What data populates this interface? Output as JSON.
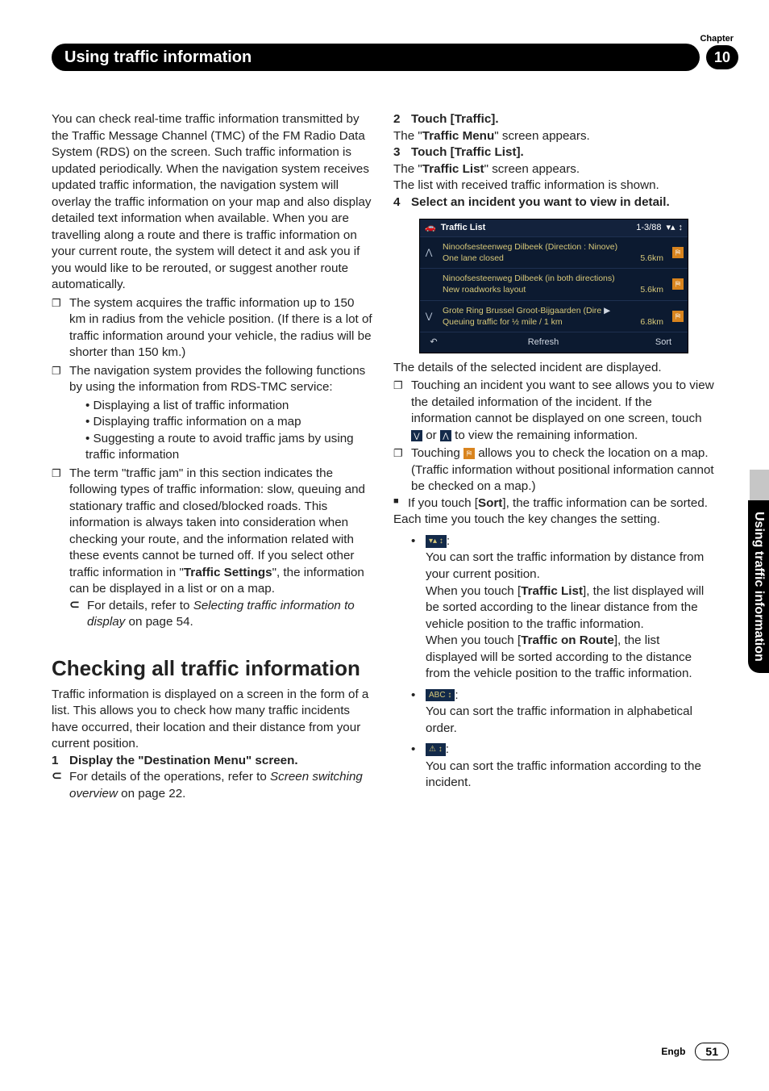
{
  "header": {
    "chapter_label": "Chapter",
    "title": "Using traffic information",
    "chapter_number": "10"
  },
  "side_tab": "Using traffic information",
  "left": {
    "intro": "You can check real-time traffic information transmitted by the Traffic Message Channel (TMC) of the FM Radio Data System (RDS) on the screen. Such traffic information is updated periodically. When the navigation system receives updated traffic information, the navigation system will overlay the traffic information on your map and also display detailed text information when available. When you are travelling along a route and there is traffic information on your current route, the system will detect it and ask you if you would like to be rerouted, or suggest another route automatically.",
    "note1": "The system acquires the traffic information up to 150 km in radius from the vehicle position. (If there is a lot of traffic information around your vehicle, the radius will be shorter than 150 km.)",
    "note2": "The navigation system provides the following functions by using the information from RDS-TMC service:",
    "bullets": [
      "Displaying a list of traffic information",
      "Displaying traffic information on a map",
      "Suggesting a route to avoid traffic jams by using traffic information"
    ],
    "note3_a": "The term \"traffic jam\" in this section indicates the following types of traffic information: slow, queuing and stationary traffic and closed/blocked roads. This information is always taken into consideration when checking your route, and the information related with these events cannot be turned off. If you select other traffic information in \"",
    "note3_bold": "Traffic Settings",
    "note3_b": "\", the information can be displayed in a list or on a map.",
    "note3_ref_a": "For details, refer to ",
    "note3_ref_i": "Selecting traffic information to display",
    "note3_ref_b": " on page 54.",
    "section": "Checking all traffic information",
    "section_p": "Traffic information is displayed on a screen in the form of a list. This allows you to check how many traffic incidents have occurred, their location and their distance from your current position.",
    "step1_n": "1",
    "step1": "Display the \"Destination Menu\" screen.",
    "step1_ref_a": "For details of the operations, refer to ",
    "step1_ref_i": "Screen switching overview",
    "step1_ref_b": " on page 22."
  },
  "right": {
    "step2_n": "2",
    "step2": "Touch [Traffic].",
    "step2_p_a": "The \"",
    "step2_p_b": "Traffic Menu",
    "step2_p_c": "\" screen appears.",
    "step3_n": "3",
    "step3": "Touch [Traffic List].",
    "step3_p_a": "The \"",
    "step3_p_b": "Traffic List",
    "step3_p_c": "\" screen appears.",
    "step3_p2": "The list with received traffic information is shown.",
    "step4_n": "4",
    "step4": "Select an incident you want to view in detail.",
    "step4_after": "The details of the selected incident are displayed.",
    "sub1_a": "Touching an incident you want to see allows you to view the detailed information of the incident. If the information cannot be displayed on one screen, touch ",
    "sub1_b": " or ",
    "sub1_c": " to view the remaining information.",
    "sub2_a": "Touching ",
    "sub2_b": " allows you to check the location on a map. (Traffic information without positional information cannot be checked on a map.)",
    "sort_a": "If you touch [",
    "sort_b": "Sort",
    "sort_c": "], the traffic information can be sorted.",
    "sort_each": "Each time you touch the key changes the setting.",
    "s1_icon": "▾▴ ↕",
    "s1_a": "You can sort the traffic information by distance from your current position.",
    "s1_b_a": "When you touch [",
    "s1_b_bold": "Traffic List",
    "s1_b_b": "], the list displayed will be sorted according to the linear distance from the vehicle position to the traffic information.",
    "s1_c_a": "When you touch [",
    "s1_c_bold": "Traffic on Route",
    "s1_c_b": "], the list displayed will be sorted according to the distance from the vehicle position to the traffic information.",
    "s2_icon": "ABC ↕",
    "s2": "You can sort the traffic information in alphabetical order.",
    "s3_icon": "⚠ ↕",
    "s3": "You can sort the traffic information according to the incident."
  },
  "screenshot": {
    "title": "Traffic List",
    "counter": "1-3/88",
    "rows": [
      {
        "line1": "Ninoofsesteenweg Dilbeek (Direction : Ninove)",
        "line2": "One lane closed",
        "km": "5.6km",
        "nav": "⋀"
      },
      {
        "line1": "Ninoofsesteenweg Dilbeek (in both directions)",
        "line2": "New roadworks layout",
        "km": "5.6km",
        "nav": ""
      },
      {
        "line1": "Grote Ring Brussel Groot-Bijgaarden (Dire",
        "line2": "Queuing traffic for ½ mile / 1 km",
        "km": "6.8km",
        "nav": "⋁",
        "arrow": "▶"
      }
    ],
    "back": "↶",
    "refresh": "Refresh",
    "sort": "Sort"
  },
  "footer": {
    "lang": "Engb",
    "page": "51"
  }
}
